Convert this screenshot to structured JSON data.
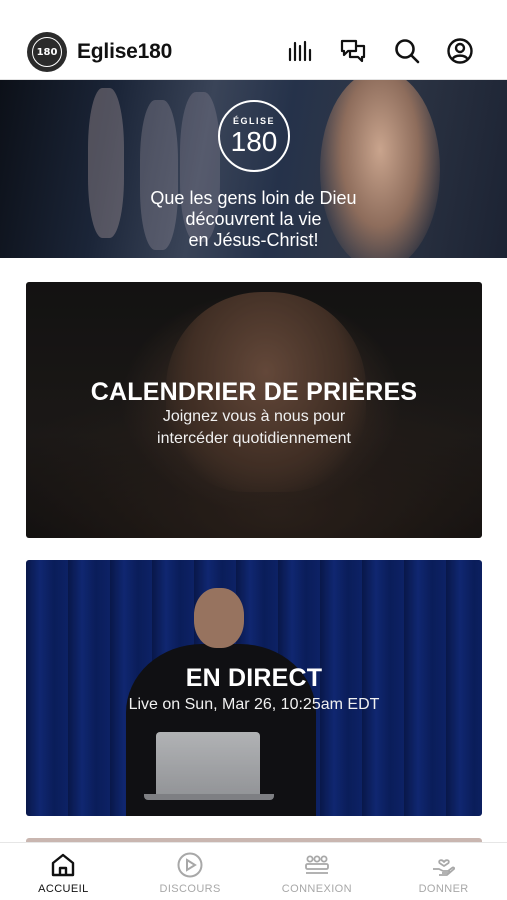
{
  "header": {
    "logo_text": "180",
    "title": "Eglise180",
    "icons": [
      "audio-bars-icon",
      "chat-bubbles-icon",
      "search-icon",
      "account-icon"
    ]
  },
  "hero": {
    "logo_top": "ÉGLISE",
    "logo_number": "180",
    "tagline_lines": [
      "Que les gens loin de Dieu",
      "découvrent la vie",
      "en Jésus-Christ!"
    ]
  },
  "cards": [
    {
      "title": "CALENDRIER DE PRIÈRES",
      "subtitle": "Joignez vous à nous pour intercéder quotidiennement"
    },
    {
      "title": "EN DIRECT",
      "subtitle": "Live on Sun, Mar 26, 10:25am EDT"
    }
  ],
  "tabs": [
    {
      "label": "ACCUEIL",
      "icon": "home-icon",
      "active": true
    },
    {
      "label": "DISCOURS",
      "icon": "play-circle-icon",
      "active": false
    },
    {
      "label": "CONNEXION",
      "icon": "people-group-icon",
      "active": false
    },
    {
      "label": "DONNER",
      "icon": "giving-hand-icon",
      "active": false
    }
  ],
  "colors": {
    "active_tab": "#111111",
    "inactive_tab": "#a8a8a8",
    "header_text": "#111111"
  }
}
